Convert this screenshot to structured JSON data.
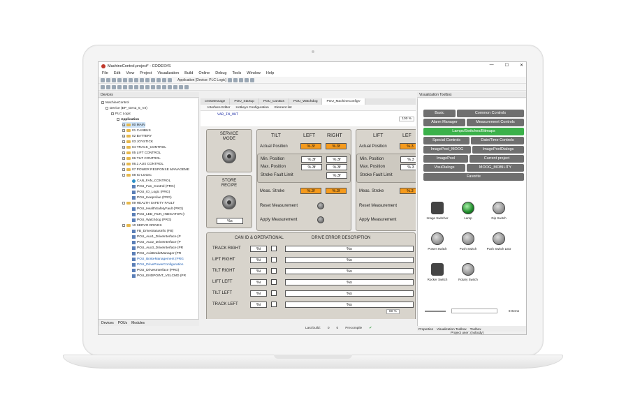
{
  "window": {
    "title": "MachineControl.project* - CODESYS",
    "controls": [
      "—",
      "☐",
      "✕"
    ]
  },
  "menu": [
    "File",
    "Edit",
    "View",
    "Project",
    "Visualization",
    "Build",
    "Online",
    "Debug",
    "Tools",
    "Window",
    "Help"
  ],
  "toolbar": {
    "application_selector": "Application [Device: PLC Logic]"
  },
  "devices_panel": {
    "title": "Devices",
    "tree": [
      "MachineControl",
      "Device (EP_Gen2_5_V2)",
      "PLC Logic",
      "Application",
      "00 MAIN",
      "01 CANBUS",
      "02 BATTERY",
      "03 JOYSTICK",
      "04 TRACK_CONTROL",
      "05 LIFT CONTROL",
      "06 TILT CONTROL",
      "06.1 AUX CONTROL",
      "07 POWER RESPONSE MANAGEME",
      "08 IO LOGIC",
      "CAN_FAN_CONTROL",
      "POU_Fan_Control (PRG)",
      "POU_IO_Logic (PRG)",
      "POU_KeepAlive (PRG)",
      "09 HEALTH SAFETY FAULT",
      "POU_HealthSafetyFault (PRG)",
      "POU_LED_RUN_INDICATOR (I",
      "POU_Watchdog (PRG)",
      "10 SERVO DRIVES",
      "FB_DriveStatusInfo (FB)",
      "POU_Aux1_DriveInterface (P",
      "POU_Aux2_DriveInterface (P",
      "POU_Aux3_DriveInterface (PR",
      "POU_AxisBrakeManager (PR",
      "POU_BrakeManagement (PRG",
      "POU_DrivePowerConfiguration",
      "POU_DrivesInterface (PRG)",
      "POU_ENDPOINT_VELCMD (PR"
    ],
    "bottom_tabs": [
      "Devices",
      "POUs",
      "Modules"
    ]
  },
  "editor": {
    "tabs": [
      "cessMessage",
      "POU_Startup",
      "POU_CanBus",
      "POU_Watchdog",
      "POU_MachineConfigV"
    ],
    "subtabs": [
      "Interface Editor",
      "Hotkeys Configuration",
      "Element list"
    ],
    "declaration": "VAR_IN_OUT",
    "zoom": "100 %"
  },
  "hmi": {
    "service_mode": "SERVICE\nMODE",
    "store_recipe": "STORE\nRECIPE",
    "recipe_value": "%s",
    "tilt_header": "TILT",
    "left": "LEFT",
    "right": "RIGHT",
    "lift_header": "LIFT",
    "lift_left": "LEF",
    "actual_position": "Actual Position",
    "min_position": "Min. Position",
    "max_position": "Max. Position",
    "stroke_fault_limit": "Stroke Fault Limit",
    "meas_stroke": "Meas. Stroke",
    "reset_measurement": "Reset Measurement",
    "apply_measurement": "Apply Measurement",
    "fmt_f": "%.3f",
    "fmt_f_short": "%.3",
    "can_header": "CAN ID & OPERATIONAL",
    "drive_error_header": "DRIVE ERROR DESCRIPTION",
    "rows": [
      "TRACK RIGHT",
      "LIFT RIGHT",
      "TILT RIGHT",
      "LIFT LEFT",
      "TILT LEFT",
      "TRACK LEFT"
    ],
    "fmt_i": "%i",
    "fmt_s": "%s",
    "canvas_zoom": "80 %"
  },
  "statusbar": {
    "last_build": "Last build:",
    "errors": "0",
    "warnings": "0",
    "precompile": "Precompile"
  },
  "toolbox": {
    "title": "Visualization Toolbox",
    "buttons": [
      "Basic",
      "Common Controls",
      "Alarm Manager",
      "Measurement Controls",
      "Lamps/Switches/Bitmaps",
      "Special Controls",
      "Date/Time Controls",
      "ImagePool_MOOG",
      "ImagePoolDialogs",
      "ImagePool",
      "Current project",
      "VisuDialogs",
      "MOOG_MOBILITY",
      "Favorite"
    ],
    "items": [
      "Image Switcher",
      "Lamp",
      "Dip Switch",
      "Power Switch",
      "Push Switch",
      "Push Switch LED",
      "Rocker Switch",
      "Rotary Switch"
    ],
    "count": "8 Items",
    "bottom_tabs": [
      "Properties",
      "Visualization Toolbox",
      "Toolbox"
    ],
    "project_user": "Project user: (nobody)"
  },
  "colors": {
    "accent_green": "#3bb14a",
    "value_orange": "#f59a1c",
    "panel_gray": "#d8d4cc"
  }
}
